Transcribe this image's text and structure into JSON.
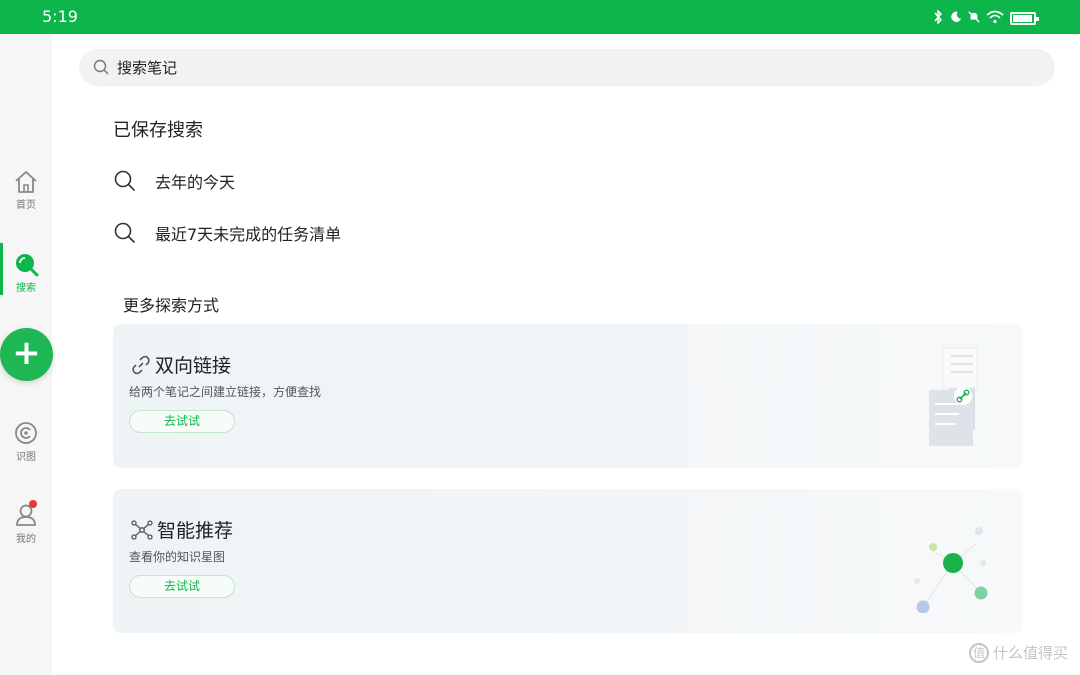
{
  "status_bar": {
    "time": "5:19"
  },
  "sidebar": {
    "items": [
      {
        "label": "首页",
        "icon": "home-icon"
      },
      {
        "label": "搜索",
        "icon": "search-icon"
      },
      {
        "label": "识图",
        "icon": "scan-icon"
      },
      {
        "label": "我的",
        "icon": "user-icon"
      }
    ],
    "fab_label": "+"
  },
  "search": {
    "placeholder": "搜索笔记"
  },
  "saved": {
    "title": "已保存搜索",
    "items": [
      "去年的今天",
      "最近7天未完成的任务清单"
    ]
  },
  "more": {
    "title": "更多探索方式",
    "cards": [
      {
        "title": "双向链接",
        "desc": "给两个笔记之间建立链接，方便查找",
        "button": "去试试",
        "icon": "link-icon"
      },
      {
        "title": "智能推荐",
        "desc": "查看你的知识星图",
        "button": "去试试",
        "icon": "graph-icon"
      }
    ]
  },
  "colors": {
    "accent": "#0db54a",
    "badge": "#e63a3a"
  },
  "watermark": {
    "text": "什么值得买",
    "logo": "值"
  }
}
